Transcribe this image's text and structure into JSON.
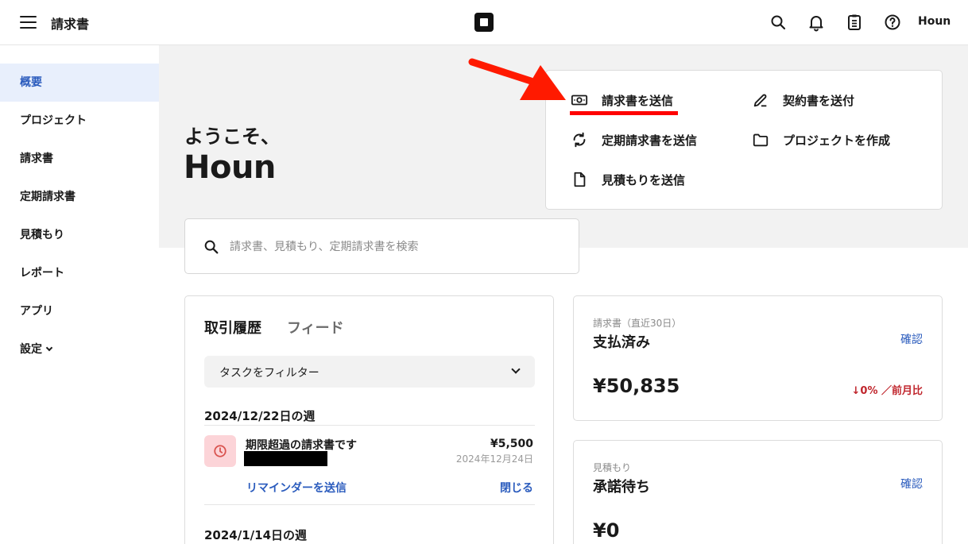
{
  "header": {
    "title": "請求書",
    "user_name": "Houn",
    "icons": [
      "menu-icon",
      "square-logo",
      "search-icon",
      "bell-icon",
      "clipboard-icon",
      "help-icon"
    ]
  },
  "sidebar": {
    "items": [
      {
        "label": "概要",
        "active": true
      },
      {
        "label": "プロジェクト"
      },
      {
        "label": "請求書"
      },
      {
        "label": "定期請求書"
      },
      {
        "label": "見積もり"
      },
      {
        "label": "レポート"
      },
      {
        "label": "アプリ"
      },
      {
        "label": "設定"
      }
    ]
  },
  "hero": {
    "greeting": "ようこそ、",
    "name": "Houn"
  },
  "actions": {
    "send_invoice": "請求書を送信",
    "send_contract": "契約書を送付",
    "send_recurring": "定期請求書を送信",
    "create_project": "プロジェクトを作成",
    "send_estimate": "見積もりを送信"
  },
  "search": {
    "placeholder": "請求書、見積もり、定期請求書を検索"
  },
  "activity": {
    "tabs": [
      "取引履歴",
      "フィード"
    ],
    "filter_label": "タスクをフィルター",
    "weeks": [
      {
        "label": "2024/12/22日の週",
        "items": [
          {
            "title": "期限超過の請求書です",
            "amount": "¥5,500",
            "date": "2024年12月24日",
            "primary_action": "リマインダーを送信",
            "secondary_action": "閉じる"
          }
        ]
      },
      {
        "label": "2024/1/14日の週",
        "items": []
      }
    ]
  },
  "stats": [
    {
      "caption": "請求書（直近30日）",
      "title": "支払済み",
      "link": "確認",
      "value": "¥50,835",
      "change": "↓0% ／前月比"
    },
    {
      "caption": "見積もり",
      "title": "承諾待ち",
      "link": "確認",
      "value": "¥0"
    }
  ],
  "colors": {
    "accent": "#2a5bbd",
    "active_bg": "#e8effc",
    "hero_bg": "#f2f2f2",
    "annotation": "#ff0000",
    "negative": "#c0262d",
    "overdue_bg": "#fcd4d8",
    "overdue_icon": "#d9534f"
  }
}
